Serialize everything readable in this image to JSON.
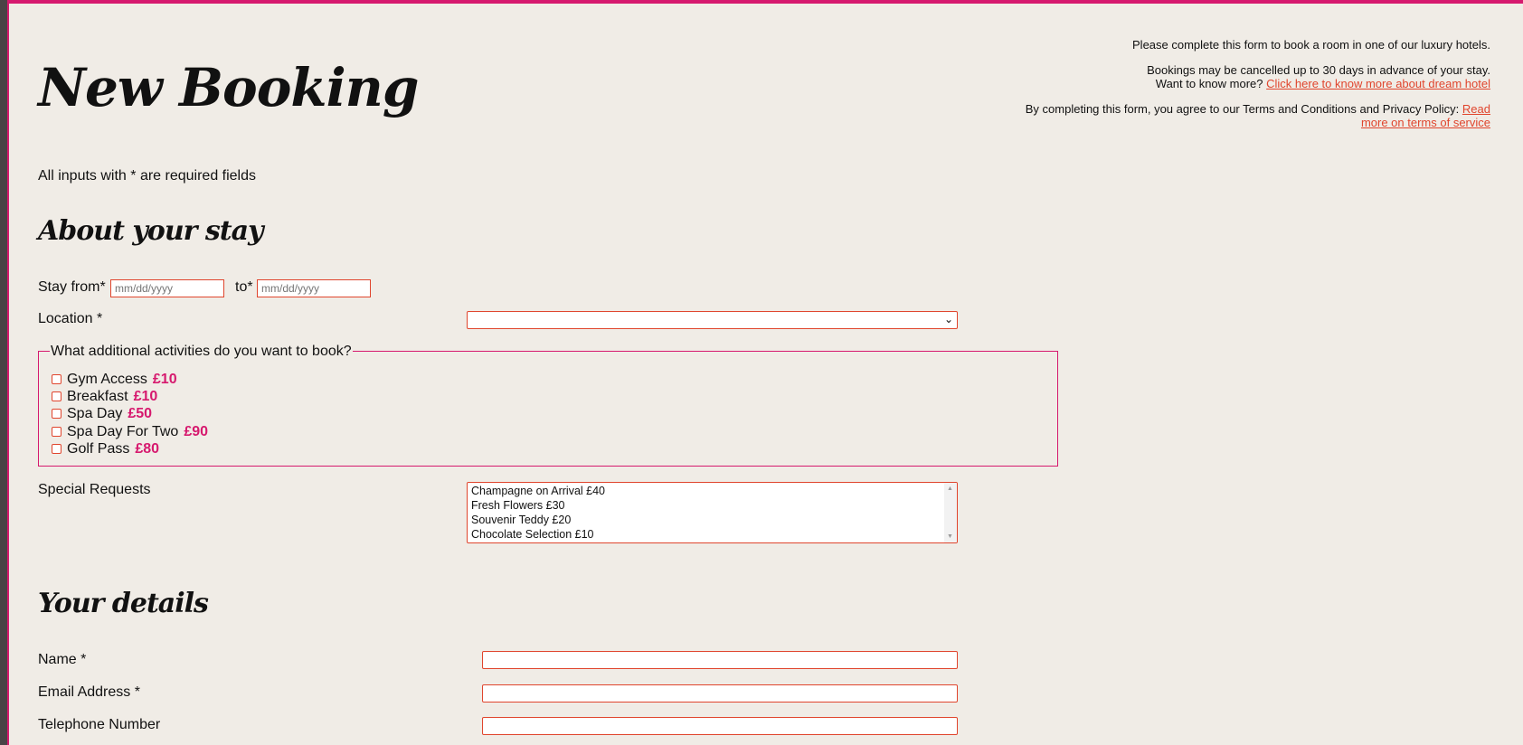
{
  "header": {
    "title": "New Booking",
    "required_note": "All inputs with * are required fields"
  },
  "info": {
    "intro": "Please complete this form to book a room in one of our luxury hotels.",
    "cancel_text": "Bookings may be cancelled up to 30 days in advance of your stay.",
    "know_more_text": "Want to know more?",
    "know_more_link": "Click here to know more about dream hotel",
    "terms_text": "By completing this form, you agree to our Terms and Conditions and Privacy Policy:",
    "terms_link": "Read more on terms of service"
  },
  "stay": {
    "heading": "About your stay",
    "from_label": "Stay from*",
    "to_label": "to*",
    "date_placeholder": "mm/dd/yyyy",
    "location_label": "Location *",
    "location_value": ""
  },
  "activities": {
    "legend": "What additional activities do you want to book?",
    "items": [
      {
        "label": "Gym Access",
        "price": "£10"
      },
      {
        "label": "Breakfast",
        "price": "£10"
      },
      {
        "label": "Spa Day",
        "price": "£50"
      },
      {
        "label": "Spa Day For Two",
        "price": "£90"
      },
      {
        "label": "Golf Pass",
        "price": "£80"
      }
    ]
  },
  "special_requests": {
    "label": "Special Requests",
    "options": [
      "Champagne on Arrival £40",
      "Fresh Flowers £30",
      "Souvenir Teddy £20",
      "Chocolate Selection £10"
    ]
  },
  "details": {
    "heading": "Your details",
    "name_label": "Name *",
    "email_label": "Email Address *",
    "phone_label": "Telephone Number"
  },
  "colors": {
    "accent": "#d6196e",
    "input_border": "#e0452d",
    "background": "#f0ece6"
  }
}
